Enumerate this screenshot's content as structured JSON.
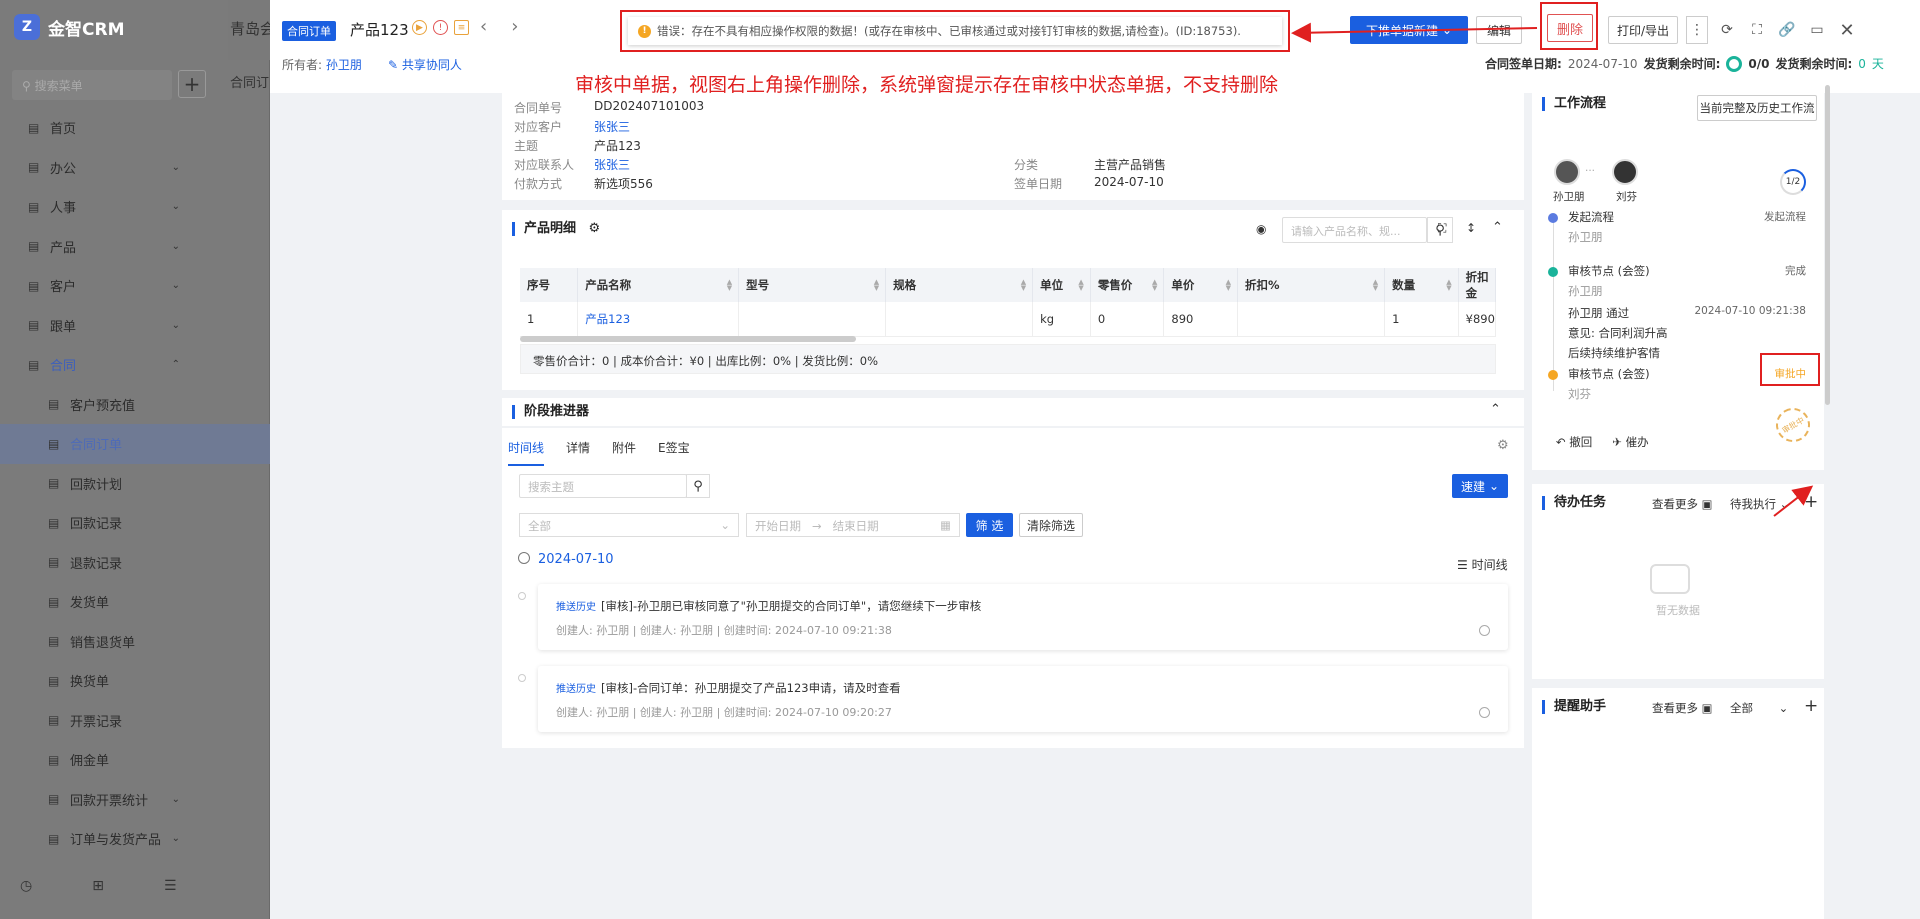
{
  "bg_app": {
    "logo": "金智CRM",
    "title": "青岛会",
    "tab": "合同订",
    "search_placeholder": "搜索菜单",
    "menu": [
      {
        "label": "首页",
        "icon": "home-icon"
      },
      {
        "label": "办公",
        "icon": "office-icon",
        "chev": "⌄"
      },
      {
        "label": "人事",
        "icon": "people-icon",
        "chev": "⌄"
      },
      {
        "label": "产品",
        "icon": "box-icon",
        "chev": "⌄"
      },
      {
        "label": "客户",
        "icon": "customer-icon",
        "chev": "⌄"
      },
      {
        "label": "跟单",
        "icon": "follow-icon",
        "chev": "⌄"
      },
      {
        "label": "合同",
        "icon": "contract-icon",
        "chev": "⌃",
        "open": true
      },
      {
        "label": "客户预充值",
        "icon": "doc-icon",
        "sub": true
      },
      {
        "label": "合同订单",
        "icon": "doc-icon",
        "sub": true,
        "active": true
      },
      {
        "label": "回款计划",
        "icon": "doc-icon",
        "sub": true
      },
      {
        "label": "回款记录",
        "icon": "doc-icon",
        "sub": true
      },
      {
        "label": "退款记录",
        "icon": "refund-icon",
        "sub": true
      },
      {
        "label": "发货单",
        "icon": "doc-icon",
        "sub": true
      },
      {
        "label": "销售退货单",
        "icon": "doc-icon",
        "sub": true
      },
      {
        "label": "换货单",
        "icon": "doc-icon",
        "sub": true
      },
      {
        "label": "开票记录",
        "icon": "doc-icon",
        "sub": true
      },
      {
        "label": "佣金单",
        "icon": "doc-icon",
        "sub": true
      },
      {
        "label": "回款开票统计",
        "icon": "doc-icon",
        "sub": true,
        "chev": "⌄"
      },
      {
        "label": "订单与发货产品",
        "icon": "doc-icon",
        "sub": true,
        "chev": "⌄"
      }
    ]
  },
  "header": {
    "badge": "合同订单",
    "title": "产品123",
    "owner_label": "所有者:",
    "owner": "孙卫朋",
    "share": "共享协同人",
    "error": "错误：存在不具有相应操作权限的数据！(或存在审核中、已审核通过或对接钉钉审核的数据,请检查)。(ID:18753).",
    "btn_push": "下推单据新建",
    "btn_edit": "编辑",
    "btn_delete": "删除",
    "btn_print": "打印/导出",
    "btn_more": "⋮",
    "sign_label": "合同签单日期:",
    "sign_date": "2024-07-10",
    "ship_label": "发货剩余时间:",
    "ship_val": "0/0",
    "ship2_label": "发货剩余时间:",
    "ship2_val": "0",
    "ship2_unit": "天"
  },
  "annotation": "审核中单据，视图右上角操作删除，系统弹窗提示存在审核中状态单据，不支持删除",
  "info": {
    "contract_no_label": "合同单号",
    "contract_no": "DD202407101003",
    "customer_label": "对应客户",
    "customer": "张张三",
    "subject_label": "主题",
    "subject": "产品123",
    "contact_label": "对应联系人",
    "contact": "张张三",
    "pay_label": "付款方式",
    "pay": "新选项556",
    "cat_label": "分类",
    "cat": "主营产品销售",
    "date_label": "签单日期",
    "date": "2024-07-10"
  },
  "products": {
    "title": "产品明细",
    "search_placeholder": "请输入产品名称、规...",
    "columns": [
      "序号",
      "产品名称",
      "型号",
      "规格",
      "单位",
      "零售价",
      "单价",
      "折扣%",
      "数量",
      "折扣金"
    ],
    "rows": [
      [
        "1",
        "产品123",
        "",
        "",
        "kg",
        "0",
        "890",
        "",
        "1",
        "¥890"
      ]
    ],
    "total": "零售价合计：0 |   成本价合计：¥0 |   出库比例：0% |   发货比例：0%"
  },
  "stage": {
    "title": "阶段推进器"
  },
  "timeline": {
    "tabs": [
      "时间线",
      "详情",
      "附件",
      "E签宝"
    ],
    "search_placeholder": "搜索主题",
    "quick": "速建",
    "select": "全部",
    "start": "开始日期",
    "end": "结束日期",
    "filter": "筛 选",
    "clear": "清除筛选",
    "date": "2024-07-10",
    "view": "时间线",
    "entries": [
      {
        "tag": "推送历史",
        "text": "[审核]-孙卫朋已审核同意了\"孙卫朋提交的合同订单\"，请您继续下一步审核",
        "meta": "创建人: 孙卫朋   |   创建人: 孙卫朋   |   创建时间: 2024-07-10 09:21:38"
      },
      {
        "tag": "推送历史",
        "text": "[审核]-合同订单：孙卫朋提交了产品123申请，请及时查看",
        "meta": "创建人: 孙卫朋   |   创建人: 孙卫朋   |   创建时间: 2024-07-10 09:20:27"
      }
    ]
  },
  "workflow": {
    "title": "工作流程",
    "btn": "当前完整及历史工作流",
    "users": [
      "孙卫朋",
      "刘芬"
    ],
    "progress": "1/2",
    "steps": [
      {
        "name": "发起流程",
        "who": "孙卫朋",
        "right": "发起流程",
        "color": "#5b7be0"
      },
      {
        "name": "审核节点 (会签)",
        "who": "孙卫朋",
        "right": "完成",
        "color": "#1ab39a"
      },
      {
        "name": "孙卫朋 通过",
        "who": "意见: 合同利润升高",
        "who2": "后续持续维护客情",
        "right": "2024-07-10 09:21:38"
      },
      {
        "name": "审核节点 (会签)",
        "who": "刘芬",
        "right": "审批中",
        "color": "#f5a623"
      }
    ],
    "stamp": "审批中",
    "revoke": "撤回",
    "urge": "催办"
  },
  "todo": {
    "title": "待办任务",
    "more": "查看更多",
    "filter": "待我执行",
    "empty": "暂无数据"
  },
  "remind": {
    "title": "提醒助手",
    "more": "查看更多",
    "filter": "全部"
  }
}
